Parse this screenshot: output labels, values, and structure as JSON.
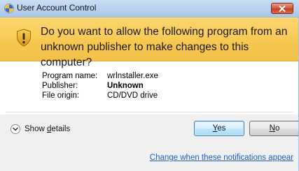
{
  "window": {
    "title": "User Account Control"
  },
  "header": {
    "question": "Do you want to allow the following program from an unknown publisher to make changes to this computer?"
  },
  "details": {
    "rows": [
      {
        "label": "Program name:",
        "value": "wrlnstaller.exe",
        "bold": false
      },
      {
        "label": "Publisher:",
        "value": "Unknown",
        "bold": true
      },
      {
        "label": "File origin:",
        "value": "CD/DVD drive",
        "bold": false
      }
    ]
  },
  "footer": {
    "show_details_prefix": "Show ",
    "show_details_key": "d",
    "show_details_suffix": "etails",
    "yes_key": "Y",
    "yes_suffix": "es",
    "no_key": "N",
    "no_suffix": "o",
    "link_text": "Change when these notifications appear"
  },
  "colors": {
    "header_band": "#f6c84f",
    "link": "#1f5fb8",
    "titlebar": "#b9d1ee",
    "close_button": "#c33d22"
  },
  "icons": {
    "title_icon": "uac-shield-icon",
    "warning_icon": "warning-shield-icon",
    "close_icon": "close-icon",
    "details_icon": "chevron-down-icon"
  }
}
